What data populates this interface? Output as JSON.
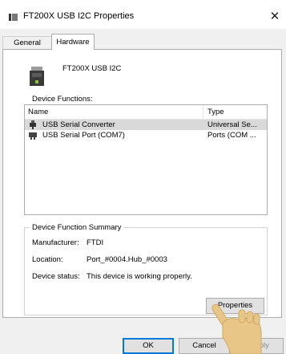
{
  "window": {
    "title": "FT200X USB I2C Properties",
    "close_glyph": "✕",
    "icon": "device-icon"
  },
  "tabs": [
    {
      "label": "General",
      "selected": false
    },
    {
      "label": "Hardware",
      "selected": true
    }
  ],
  "device": {
    "name": "FT200X USB I2C",
    "icon": "usb-device-icon"
  },
  "device_functions": {
    "label": "Device Functions:",
    "columns": {
      "name": "Name",
      "type": "Type"
    },
    "rows": [
      {
        "name": "USB Serial Converter",
        "type": "Universal Se...",
        "selected": true,
        "icon": "usb-plug-icon"
      },
      {
        "name": "USB Serial Port (COM7)",
        "type": "Ports (COM ...",
        "selected": false,
        "icon": "port-icon"
      }
    ]
  },
  "summary": {
    "legend": "Device Function Summary",
    "manufacturer_label": "Manufacturer:",
    "manufacturer_value": "FTDI",
    "location_label": "Location:",
    "location_value": "Port_#0004.Hub_#0003",
    "status_label": "Device status:",
    "status_value": "This device is working properly.",
    "properties_button": "Properties"
  },
  "footer": {
    "ok": "OK",
    "cancel": "Cancel",
    "apply": "Apply"
  },
  "colors": {
    "accent": "#0078d7",
    "selection": "#d9d9d9",
    "cursor": "#e8c688"
  }
}
